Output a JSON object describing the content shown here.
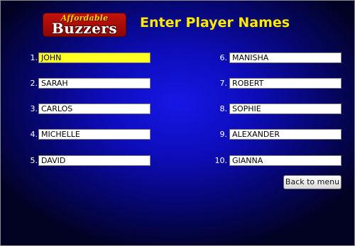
{
  "logo": {
    "line1": "Affordable",
    "line2": "Buzzers"
  },
  "title": "Enter Player Names",
  "players": [
    {
      "num": "1.",
      "name": "JOHN"
    },
    {
      "num": "2.",
      "name": "SARAH"
    },
    {
      "num": "3.",
      "name": "CARLOS"
    },
    {
      "num": "4.",
      "name": "MICHELLE"
    },
    {
      "num": "5.",
      "name": "DAVID"
    },
    {
      "num": "6.",
      "name": "MANISHA"
    },
    {
      "num": "7.",
      "name": "ROBERT"
    },
    {
      "num": "8.",
      "name": "SOPHIE"
    },
    {
      "num": "9.",
      "name": "ALEXANDER"
    },
    {
      "num": "10.",
      "name": "GIANNA"
    }
  ],
  "back_button": "Back to menu",
  "colors": {
    "background": "#0d0dbb",
    "title": "#ffea00",
    "active_field": "#ffff22",
    "logo_red": "#c4120c",
    "logo_gold": "#ffd200"
  }
}
